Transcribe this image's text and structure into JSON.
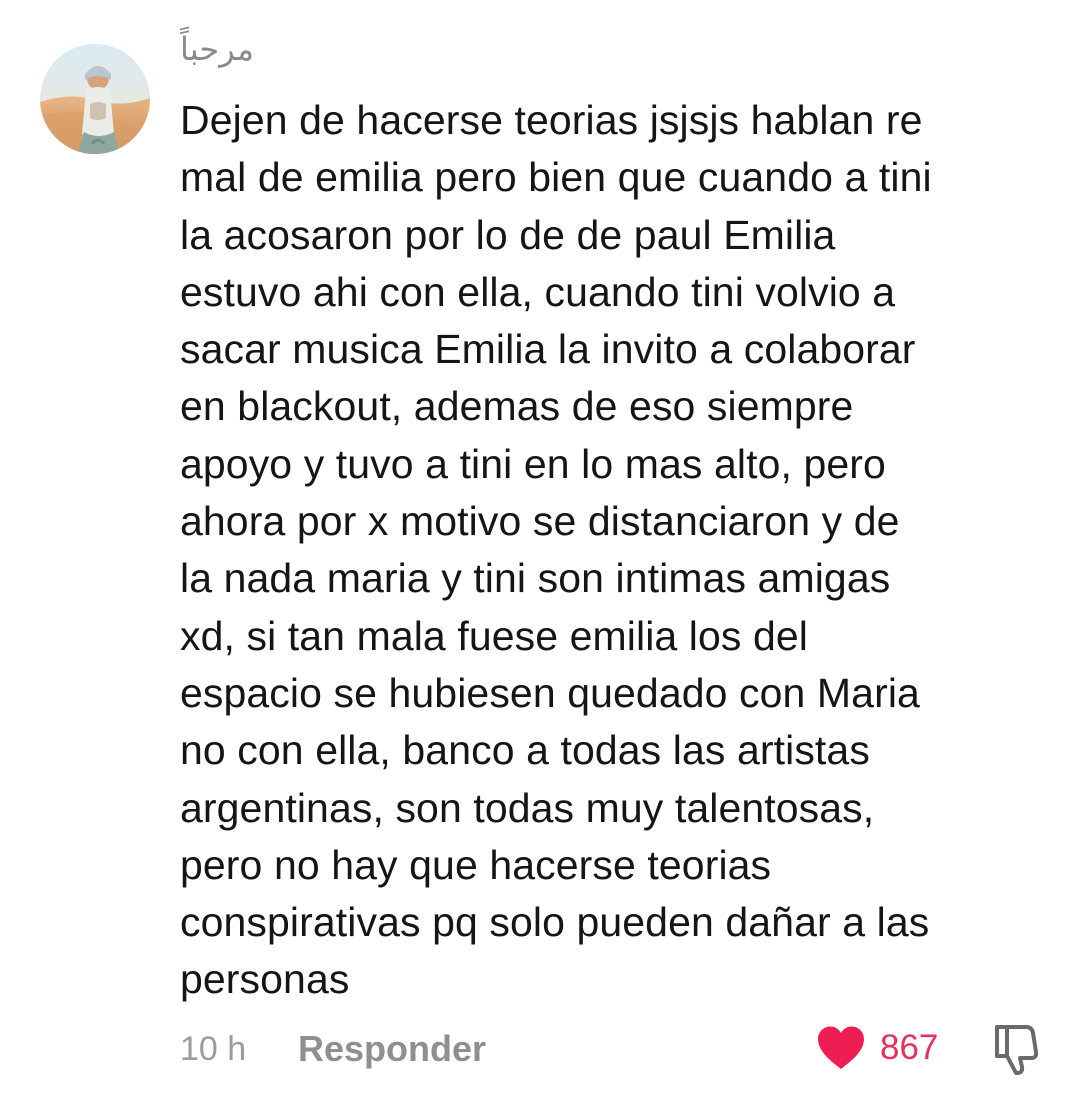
{
  "comment": {
    "username": "مرحباً",
    "text": "Dejen de hacerse teorias jsjsjs hablan re\nmal de emilia pero bien que cuando a tini\nla acosaron por lo de de paul Emilia\nestuvo ahi con ella, cuando tini volvio a\nsacar musica Emilia la invito a colaborar\nen blackout, ademas de eso siempre\napoyo y tuvo a tini en lo mas alto, pero\nahora por x motivo se distanciaron y de\nla nada maria y tini son intimas amigas\nxd, si tan mala fuese emilia los del\nespacio se hubiesen quedado con Maria\nno con ella, banco a todas las artistas\nargentinas, son todas muy talentosas,\npero no hay que hacerse teorias\nconspirativas pq solo pueden dañar a las\npersonas",
    "timestamp": "10 h",
    "reply_label": "Responder",
    "like_count": "867",
    "liked": true
  },
  "icons": {
    "avatar": "avatar-photo",
    "like": "heart-icon",
    "dislike": "thumbs-down-icon"
  },
  "colors": {
    "heart": "#ee1d52",
    "like_count": "#e5325a",
    "muted_text": "#8f8f8f"
  }
}
